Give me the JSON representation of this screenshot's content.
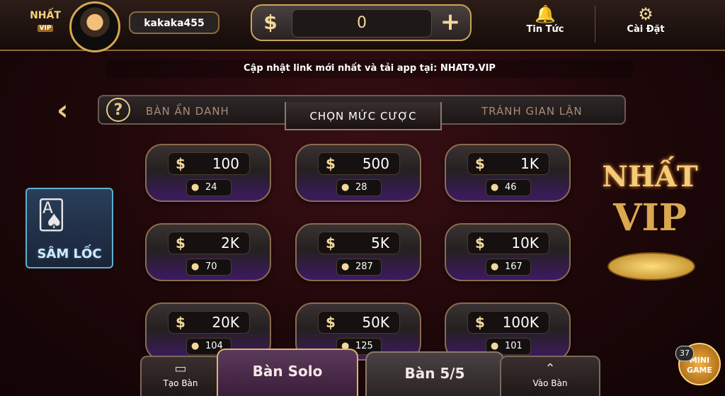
{
  "header": {
    "logo": {
      "line1": "NHẤT",
      "line2": "VIP"
    },
    "username": "kakaka455",
    "balance": "0",
    "balance_currency_icon": "$",
    "add_funds_icon": "+",
    "news_label": "Tin Tức",
    "settings_label": "Cài Đặt"
  },
  "marquee": "Cập nhật link mới nhất và tải app tại: NHAT9.VIP",
  "tabs": {
    "anonymous": "BÀN ẨN DANH",
    "bet_level": "CHỌN MỨC CƯỢC",
    "anti_cheat": "TRÁNH GIAN LẬN"
  },
  "bets": [
    {
      "amount": "100",
      "players": "24"
    },
    {
      "amount": "500",
      "players": "28"
    },
    {
      "amount": "1K",
      "players": "46"
    },
    {
      "amount": "2K",
      "players": "70"
    },
    {
      "amount": "5K",
      "players": "287"
    },
    {
      "amount": "10K",
      "players": "167"
    },
    {
      "amount": "20K",
      "players": "104"
    },
    {
      "amount": "50K",
      "players": "125"
    },
    {
      "amount": "100K",
      "players": "101"
    }
  ],
  "game_tile": {
    "label": "SÂM LỐC"
  },
  "brand_logo": {
    "top": "NHẤT",
    "bottom": "VIP"
  },
  "bottom": {
    "create_table": "Tạo Bàn",
    "solo_table": "Bàn Solo",
    "table_55": "Bàn 5/5",
    "join_table": "Vào Bàn"
  },
  "minigame": {
    "badge": "37",
    "line1": "MINI",
    "line2": "GAME"
  },
  "colors": {
    "gold": "#c9a45a",
    "purple": "#3d1a63",
    "background": "#1d0709"
  }
}
